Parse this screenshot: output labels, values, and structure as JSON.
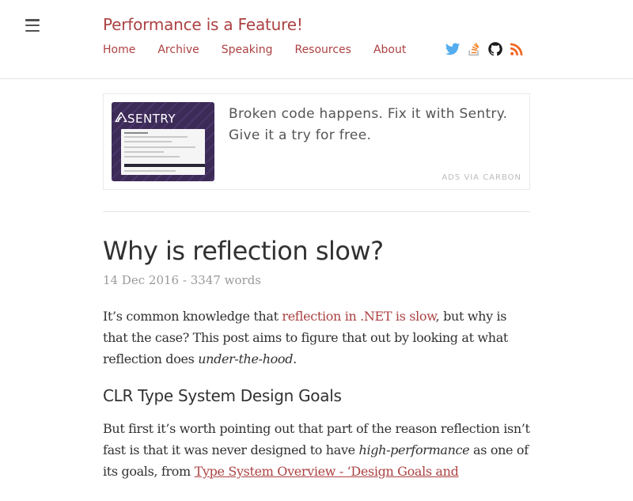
{
  "site": {
    "title": "Performance is a Feature!"
  },
  "nav": [
    {
      "label": "Home"
    },
    {
      "label": "Archive"
    },
    {
      "label": "Speaking"
    },
    {
      "label": "Resources"
    },
    {
      "label": "About"
    }
  ],
  "social": [
    "twitter-icon",
    "stackoverflow-icon",
    "github-icon",
    "rss-icon"
  ],
  "ad": {
    "brand": "SENTRY",
    "text": "Broken code happens. Fix it with Sentry. Give it a try for free.",
    "powered_by": "ADS VIA CARBON"
  },
  "post": {
    "title": "Why is reflection slow?",
    "meta": "14 Dec 2016 - 3347 words",
    "intro_before": "It’s common knowledge that ",
    "intro_link": "reflection in .NET is slow",
    "intro_mid": ", but why is that the case? This post aims to figure that out by looking at what reflection does ",
    "intro_em": "under-the-hood",
    "intro_end": ".",
    "section_heading": "CLR Type System Design Goals",
    "p2_before": "But first it’s worth pointing out that part of the reason reflection isn’t fast is that it was never designed to have ",
    "p2_em": "high-performance",
    "p2_mid": " as one of its goals, from ",
    "p2_link": "Type System Overview - ‘Design Goals and"
  },
  "colors": {
    "accent": "#ac4142",
    "text": "#313131",
    "muted": "#9a9a9a",
    "ad_bg": "#3c2a57"
  }
}
